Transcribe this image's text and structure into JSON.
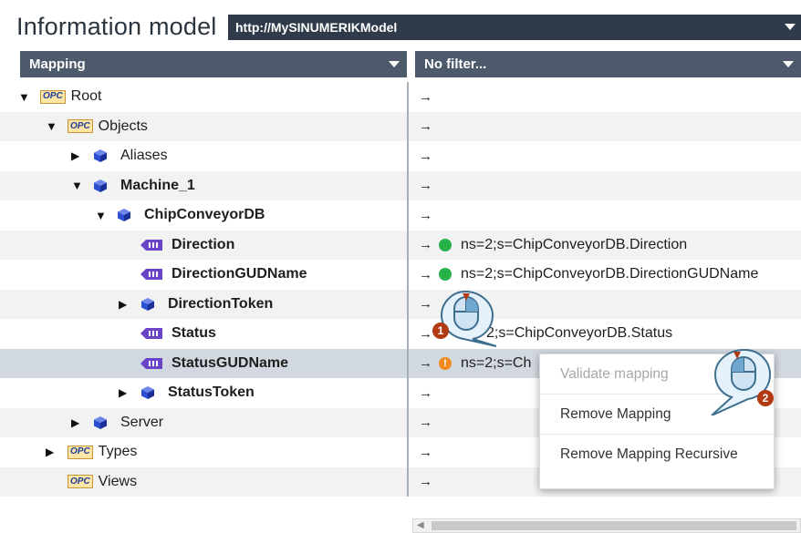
{
  "header": {
    "title": "Information model",
    "model_url": "http://MySINUMERIKModel"
  },
  "columns": {
    "mapping": "Mapping",
    "filter": "No filter..."
  },
  "tree": [
    {
      "label": "Root",
      "icon": "opc-folder-icon",
      "expand": "expanded",
      "bold": false
    },
    {
      "label": "Objects",
      "icon": "opc-folder-icon",
      "expand": "expanded",
      "bold": false
    },
    {
      "label": "Aliases",
      "icon": "object-cube-icon",
      "expand": "collapsed",
      "bold": false
    },
    {
      "label": "Machine_1",
      "icon": "object-cube-icon",
      "expand": "expanded",
      "bold": true
    },
    {
      "label": "ChipConveyorDB",
      "icon": "object-cube-icon",
      "expand": "expanded",
      "bold": true
    },
    {
      "label": "Direction",
      "icon": "variable-icon",
      "expand": "none",
      "bold": true,
      "mapping": "ns=2;s=ChipConveyorDB.Direction",
      "status": "ok"
    },
    {
      "label": "DirectionGUDName",
      "icon": "variable-icon",
      "expand": "none",
      "bold": true,
      "mapping": "ns=2;s=ChipConveyorDB.DirectionGUDName",
      "status": "ok"
    },
    {
      "label": "DirectionToken",
      "icon": "object-cube-icon",
      "expand": "collapsed",
      "bold": true
    },
    {
      "label": "Status",
      "icon": "variable-icon",
      "expand": "none",
      "bold": true,
      "mapping": "2;s=ChipConveyorDB.Status",
      "status": "hidden"
    },
    {
      "label": "StatusGUDName",
      "icon": "variable-icon",
      "expand": "none",
      "bold": true,
      "mapping": "ns=2;s=Ch",
      "status": "warning"
    },
    {
      "label": "StatusToken",
      "icon": "object-cube-icon",
      "expand": "collapsed",
      "bold": true
    },
    {
      "label": "Server",
      "icon": "object-cube-icon",
      "expand": "collapsed",
      "bold": false
    },
    {
      "label": "Types",
      "icon": "opc-folder-icon",
      "expand": "collapsed",
      "bold": false
    },
    {
      "label": "Views",
      "icon": "opc-folder-icon",
      "expand": "none",
      "bold": false
    }
  ],
  "opc_icon_text": "OPC",
  "arrow_glyph": "→",
  "warning_glyph": "!",
  "context_menu": {
    "items": [
      {
        "label": "Validate mapping",
        "enabled": false
      },
      {
        "label": "Remove Mapping",
        "enabled": true
      },
      {
        "label": "Remove Mapping Recursive",
        "enabled": true
      }
    ]
  },
  "callouts": {
    "step1": "1",
    "step2": "2"
  },
  "colors": {
    "header_bar": "#2f3b4a",
    "column_header": "#4c5a6b",
    "selection": "#d2d8df",
    "ok": "#28b34a",
    "warning": "#f08a1c",
    "cube": "#2b4fd0",
    "variable": "#6a43c9",
    "callout_badge": "#b23a12"
  }
}
